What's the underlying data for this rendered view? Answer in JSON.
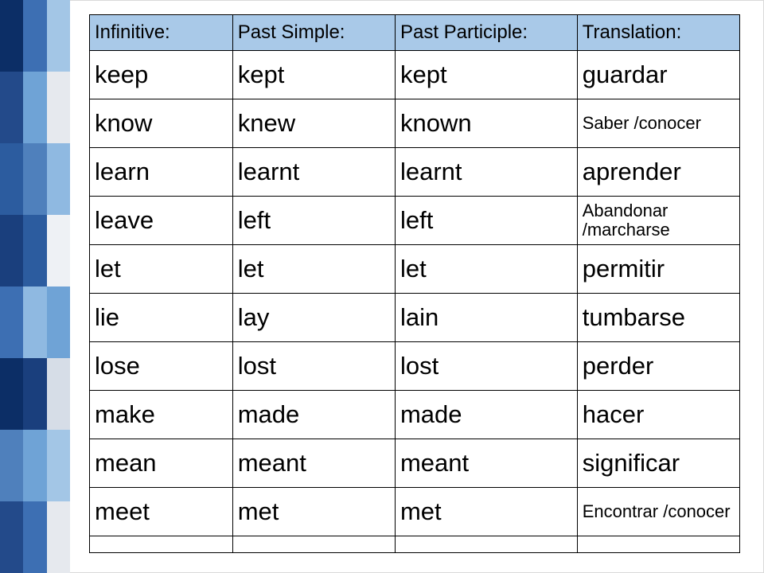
{
  "headers": {
    "infinitive": "Infinitive:",
    "past_simple": "Past Simple:",
    "past_participle": "Past Participle:",
    "translation": "Translation:"
  },
  "rows": [
    {
      "inf": "keep",
      "ps": "kept",
      "pp": "kept",
      "tr": "guardar",
      "small": false
    },
    {
      "inf": "know",
      "ps": "knew",
      "pp": "known",
      "tr": "Saber /conocer",
      "small": true
    },
    {
      "inf": "learn",
      "ps": "learnt",
      "pp": "learnt",
      "tr": "aprender",
      "small": false
    },
    {
      "inf": "leave",
      "ps": "left",
      "pp": "left",
      "tr": "Abandonar /marcharse",
      "small": true
    },
    {
      "inf": "let",
      "ps": "let",
      "pp": "let",
      "tr": "permitir",
      "small": false
    },
    {
      "inf": "lie",
      "ps": "lay",
      "pp": "lain",
      "tr": "tumbarse",
      "small": false
    },
    {
      "inf": "lose",
      "ps": "lost",
      "pp": "lost",
      "tr": "perder",
      "small": false
    },
    {
      "inf": "make",
      "ps": "made",
      "pp": "made",
      "tr": "hacer",
      "small": false
    },
    {
      "inf": "mean",
      "ps": "meant",
      "pp": "meant",
      "tr": "significar",
      "small": false
    },
    {
      "inf": "meet",
      "ps": "met",
      "pp": "met",
      "tr": "Encontrar /conocer",
      "small": true
    }
  ]
}
